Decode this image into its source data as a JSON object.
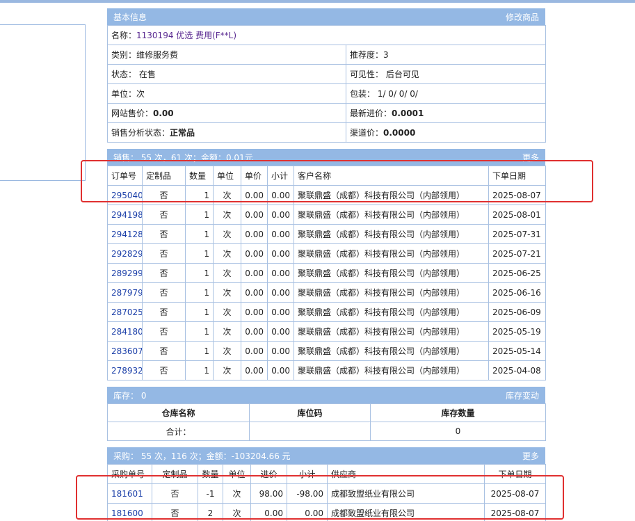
{
  "basic": {
    "header": "基本信息",
    "action": "修改商品",
    "name_label": "名称：",
    "name_value": "1130194 优选 费用(F**L)",
    "category": "类别：维修服务费",
    "recommend": "推荐度：3",
    "status": "状态： 在售",
    "visibility": "可见性： 后台可见",
    "unit": "单位：次",
    "package": "包装： 1/ 0/ 0/ 0/",
    "site_price_label": "网站售价：",
    "site_price": "0.00",
    "latest_cost_label": "最新进价：",
    "latest_cost": "0.0001",
    "sales_status_label": "销售分析状态：",
    "sales_status": "正常品",
    "channel_label": "渠道价：",
    "channel_price": "0.0000"
  },
  "sales": {
    "header": "销售： 55 次，61 次；金额：0.01元",
    "more": "更多",
    "columns": [
      "订单号",
      "定制品",
      "数量",
      "单位",
      "单价",
      "小计",
      "客户名称",
      "下单日期"
    ],
    "rows": [
      [
        "295040",
        "否",
        "1",
        "次",
        "0.00",
        "0.00",
        "聚联鼎盛（成都）科技有限公司（内部领用）",
        "2025-08-07"
      ],
      [
        "294198",
        "否",
        "1",
        "次",
        "0.00",
        "0.00",
        "聚联鼎盛（成都）科技有限公司（内部领用）",
        "2025-08-01"
      ],
      [
        "294128",
        "否",
        "1",
        "次",
        "0.00",
        "0.00",
        "聚联鼎盛（成都）科技有限公司（内部领用）",
        "2025-07-31"
      ],
      [
        "292829",
        "否",
        "1",
        "次",
        "0.00",
        "0.00",
        "聚联鼎盛（成都）科技有限公司（内部领用）",
        "2025-07-21"
      ],
      [
        "289299",
        "否",
        "1",
        "次",
        "0.00",
        "0.00",
        "聚联鼎盛（成都）科技有限公司（内部领用）",
        "2025-06-25"
      ],
      [
        "287979",
        "否",
        "1",
        "次",
        "0.00",
        "0.00",
        "聚联鼎盛（成都）科技有限公司（内部领用）",
        "2025-06-16"
      ],
      [
        "287025",
        "否",
        "1",
        "次",
        "0.00",
        "0.00",
        "聚联鼎盛（成都）科技有限公司（内部领用）",
        "2025-06-09"
      ],
      [
        "284180",
        "否",
        "1",
        "次",
        "0.00",
        "0.00",
        "聚联鼎盛（成都）科技有限公司（内部领用）",
        "2025-05-19"
      ],
      [
        "283607",
        "否",
        "1",
        "次",
        "0.00",
        "0.00",
        "聚联鼎盛（成都）科技有限公司（内部领用）",
        "2025-05-14"
      ],
      [
        "278932",
        "否",
        "1",
        "次",
        "0.00",
        "0.00",
        "聚联鼎盛（成都）科技有限公司（内部领用）",
        "2025-04-08"
      ]
    ]
  },
  "stock": {
    "header": "库存： 0",
    "action": "库存变动",
    "columns": [
      "仓库名称",
      "库位码",
      "库存数量"
    ],
    "total_label": "合计：",
    "total_location": "",
    "total_qty": "0"
  },
  "purchase": {
    "header": "采购： 55 次，116 次；金额：-103204.66 元",
    "more": "更多",
    "columns": [
      "采购单号",
      "定制品",
      "数量",
      "单位",
      "进价",
      "小计",
      "供应商",
      "下单日期"
    ],
    "rows": [
      [
        "181601",
        "否",
        "-1",
        "次",
        "98.00",
        "-98.00",
        "成都致盟纸业有限公司",
        "2025-08-07"
      ],
      [
        "181600",
        "否",
        "2",
        "次",
        "0.00",
        "0.00",
        "成都致盟纸业有限公司",
        "2025-08-07"
      ]
    ]
  },
  "colors": {
    "header_bg": "#94b8e4",
    "border": "#a9c1e2",
    "highlight": "#e03030",
    "link": "#1a3ea8"
  }
}
